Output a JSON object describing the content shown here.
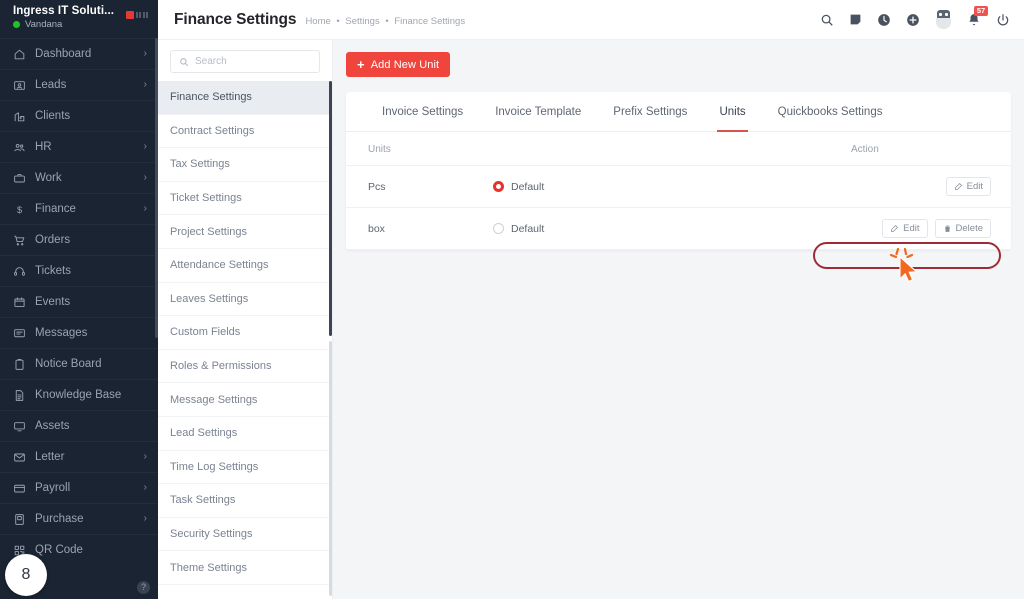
{
  "sidebar": {
    "company": "Ingress IT Soluti...",
    "user": "Vandana",
    "status_color": "#20c422",
    "items": [
      {
        "label": "Dashboard",
        "icon": "home-icon",
        "chevron": "›"
      },
      {
        "label": "Leads",
        "icon": "leads-icon",
        "chevron": "›"
      },
      {
        "label": "Clients",
        "icon": "clients-icon",
        "chevron": ""
      },
      {
        "label": "HR",
        "icon": "people-icon",
        "chevron": "›"
      },
      {
        "label": "Work",
        "icon": "briefcase-icon",
        "chevron": "›"
      },
      {
        "label": "Finance",
        "icon": "dollar-icon",
        "chevron": "›"
      },
      {
        "label": "Orders",
        "icon": "cart-icon",
        "chevron": ""
      },
      {
        "label": "Tickets",
        "icon": "headset-icon",
        "chevron": ""
      },
      {
        "label": "Events",
        "icon": "calendar-icon",
        "chevron": ""
      },
      {
        "label": "Messages",
        "icon": "chat-icon",
        "chevron": ""
      },
      {
        "label": "Notice Board",
        "icon": "clipboard-icon",
        "chevron": ""
      },
      {
        "label": "Knowledge Base",
        "icon": "document-icon",
        "chevron": ""
      },
      {
        "label": "Assets",
        "icon": "monitor-icon",
        "chevron": ""
      },
      {
        "label": "Letter",
        "icon": "envelope-icon",
        "chevron": "›"
      },
      {
        "label": "Payroll",
        "icon": "wallet-icon",
        "chevron": "›"
      },
      {
        "label": "Purchase",
        "icon": "purchase-icon",
        "chevron": "›"
      },
      {
        "label": "QR Code",
        "icon": "qrcode-icon",
        "chevron": ""
      }
    ],
    "help_label": "?",
    "step_number": "8"
  },
  "header": {
    "title": "Finance Settings",
    "breadcrumb": [
      "Home",
      "Settings",
      "Finance Settings"
    ],
    "breadcrumb_separator": "•",
    "icons": [
      {
        "name": "search-icon"
      },
      {
        "name": "note-icon"
      },
      {
        "name": "clock-icon"
      },
      {
        "name": "plus-circle-icon"
      },
      {
        "name": "avatar-icon"
      },
      {
        "name": "bell-icon",
        "badge": "57"
      },
      {
        "name": "power-icon"
      }
    ]
  },
  "settings_menu": {
    "search_placeholder": "Search",
    "search_value": "",
    "active": "Finance Settings",
    "items": [
      "Finance Settings",
      "Contract Settings",
      "Tax Settings",
      "Ticket Settings",
      "Project Settings",
      "Attendance Settings",
      "Leaves Settings",
      "Custom Fields",
      "Roles & Permissions",
      "Message Settings",
      "Lead Settings",
      "Time Log Settings",
      "Task Settings",
      "Security Settings",
      "Theme Settings"
    ]
  },
  "panel": {
    "add_button": "Add New Unit",
    "add_button_color": "#f0453c",
    "tabs": [
      {
        "label": "Invoice Settings",
        "active": false
      },
      {
        "label": "Invoice Template",
        "active": false
      },
      {
        "label": "Prefix Settings",
        "active": false
      },
      {
        "label": "Units",
        "active": true
      },
      {
        "label": "Quickbooks Settings",
        "active": false
      }
    ],
    "table": {
      "headers": {
        "unit": "Units",
        "action": "Action"
      },
      "default_label": "Default",
      "rows": [
        {
          "unit": "Pcs",
          "is_default": true,
          "actions": [
            {
              "label": "Edit",
              "icon": "edit-icon"
            }
          ]
        },
        {
          "unit": "box",
          "is_default": false,
          "actions": [
            {
              "label": "Edit",
              "icon": "edit-icon"
            },
            {
              "label": "Delete",
              "icon": "trash-icon"
            }
          ]
        }
      ]
    }
  },
  "annotation": {
    "highlight_color": "#9e2b35",
    "cursor_color": "#f4671e",
    "target": "box-default-radio"
  }
}
